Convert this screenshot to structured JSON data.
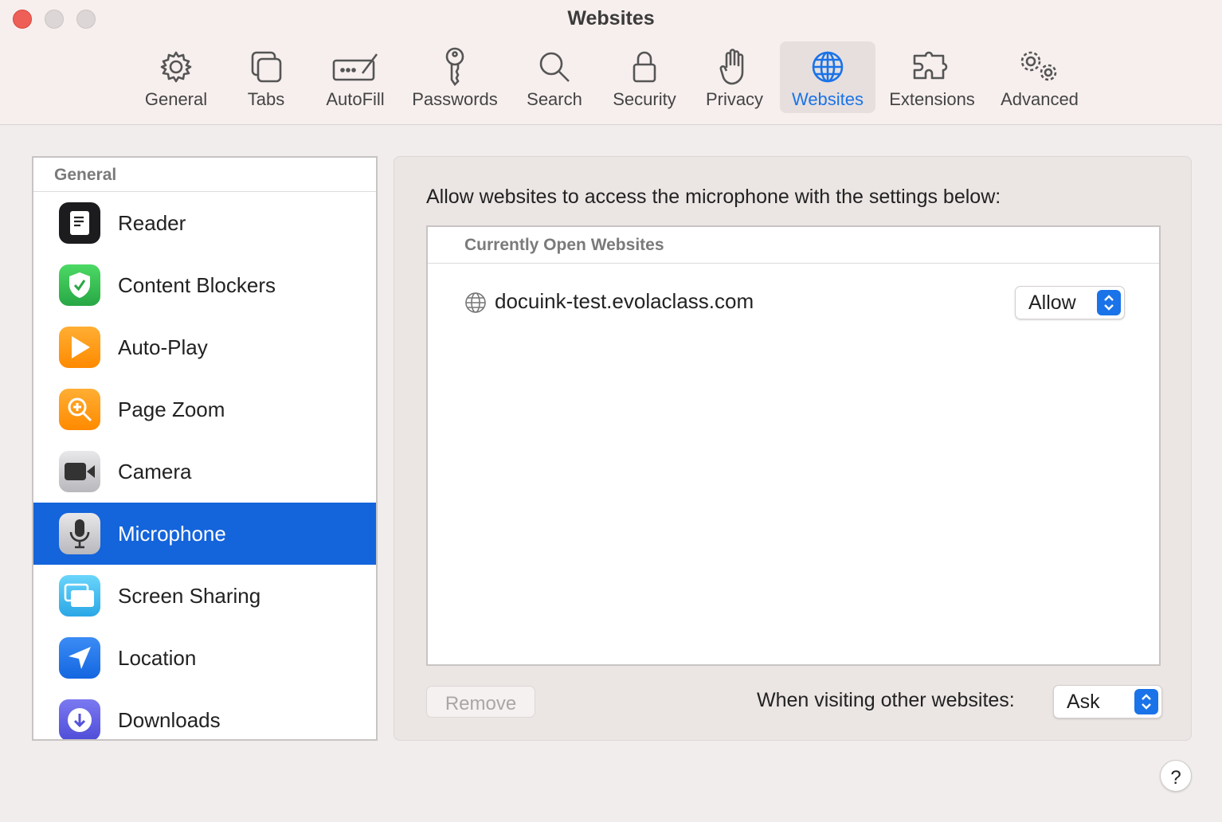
{
  "window": {
    "title": "Websites"
  },
  "toolbar": {
    "tabs": [
      {
        "label": "General",
        "icon": "gear-icon"
      },
      {
        "label": "Tabs",
        "icon": "tabs-icon"
      },
      {
        "label": "AutoFill",
        "icon": "autofill-icon"
      },
      {
        "label": "Passwords",
        "icon": "key-icon"
      },
      {
        "label": "Search",
        "icon": "magnifier-icon"
      },
      {
        "label": "Security",
        "icon": "lock-icon"
      },
      {
        "label": "Privacy",
        "icon": "hand-icon"
      },
      {
        "label": "Websites",
        "icon": "globe-icon",
        "selected": true
      },
      {
        "label": "Extensions",
        "icon": "puzzle-icon"
      },
      {
        "label": "Advanced",
        "icon": "gears-icon"
      }
    ],
    "accent_color": "#1a73e8"
  },
  "sidebar": {
    "header": "General",
    "items": [
      {
        "label": "Reader",
        "icon": "reader-icon",
        "color": "#1c1c1e"
      },
      {
        "label": "Content Blockers",
        "icon": "shield-icon",
        "color": "#34c759"
      },
      {
        "label": "Auto-Play",
        "icon": "play-icon",
        "color": "#ff9500"
      },
      {
        "label": "Page Zoom",
        "icon": "zoom-icon",
        "color": "#ff9500"
      },
      {
        "label": "Camera",
        "icon": "camera-icon",
        "color": "#d1d1d6"
      },
      {
        "label": "Microphone",
        "icon": "microphone-icon",
        "color": "#d1d1d6",
        "selected": true
      },
      {
        "label": "Screen Sharing",
        "icon": "screen-sharing-icon",
        "color": "#5ac8fa"
      },
      {
        "label": "Location",
        "icon": "location-arrow-icon",
        "color": "#1a73e8"
      },
      {
        "label": "Downloads",
        "icon": "download-icon",
        "color": "#5e5ce6"
      }
    ],
    "selection_color": "#1464db"
  },
  "main": {
    "description": "Allow websites to access the microphone with the settings below:",
    "table_header": "Currently Open Websites",
    "sites": [
      {
        "host": "docuink-test.evolaclass.com",
        "setting": "Allow"
      }
    ],
    "remove_label": "Remove",
    "other_label": "When visiting other websites:",
    "other_value": "Ask"
  },
  "help": {
    "label": "?"
  }
}
